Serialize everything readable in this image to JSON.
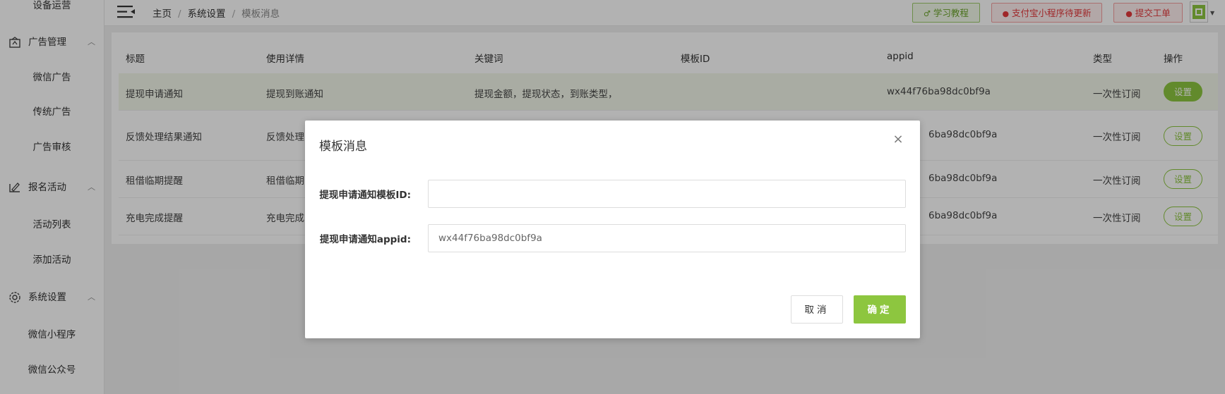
{
  "sidebar": {
    "top_item": "设备运营",
    "groups": [
      {
        "label": "广告管理",
        "icon": "ad-icon",
        "items": [
          "微信广告",
          "传统广告",
          "广告审核"
        ]
      },
      {
        "label": "报名活动",
        "icon": "signup-icon",
        "items": [
          "活动列表",
          "添加活动"
        ]
      },
      {
        "label": "系统设置",
        "icon": "gear-icon",
        "items": [
          "微信小程序",
          "微信公众号"
        ]
      }
    ]
  },
  "topbar": {
    "breadcrumb": [
      "主页",
      "系统设置",
      "模板消息"
    ],
    "separator": "/",
    "buttons": {
      "tutorial": "学习教程",
      "alipay_update": "支付宝小程序待更新",
      "submit_ticket": "提交工单"
    }
  },
  "table": {
    "headers": [
      "标题",
      "使用详情",
      "关键词",
      "模板ID",
      "appid",
      "类型",
      "操作"
    ],
    "rows": [
      {
        "title": "提现申请通知",
        "detail": "提现到账通知",
        "keywords": "提现金额，提现状态，到账类型，",
        "template_id": "",
        "appid": "wx44f76ba98dc0bf9a",
        "type": "一次性订阅",
        "action": "设置"
      },
      {
        "title": "反馈处理结果通知",
        "detail": "反馈处理",
        "keywords": "",
        "template_id": "",
        "appid": "6ba98dc0bf9a",
        "type": "一次性订阅",
        "action": "设置"
      },
      {
        "title": "租借临期提醒",
        "detail": "租借临期",
        "keywords": "",
        "template_id": "",
        "appid": "6ba98dc0bf9a",
        "type": "一次性订阅",
        "action": "设置"
      },
      {
        "title": "充电完成提醒",
        "detail": "充电完成",
        "keywords": "",
        "template_id": "",
        "appid": "6ba98dc0bf9a",
        "type": "一次性订阅",
        "action": "设置"
      }
    ]
  },
  "modal": {
    "title": "模板消息",
    "close_glyph": "×",
    "fields": [
      {
        "label": "提现申请通知模板ID:",
        "value": ""
      },
      {
        "label": "提现申请通知appid:",
        "value": "wx44f76ba98dc0bf9a"
      }
    ],
    "cancel_label": "取消",
    "confirm_label": "确定"
  },
  "colors": {
    "accent_green": "#8dc63f",
    "alert_red": "#e4393c",
    "overlay": "rgba(0,0,0,0.3)"
  }
}
